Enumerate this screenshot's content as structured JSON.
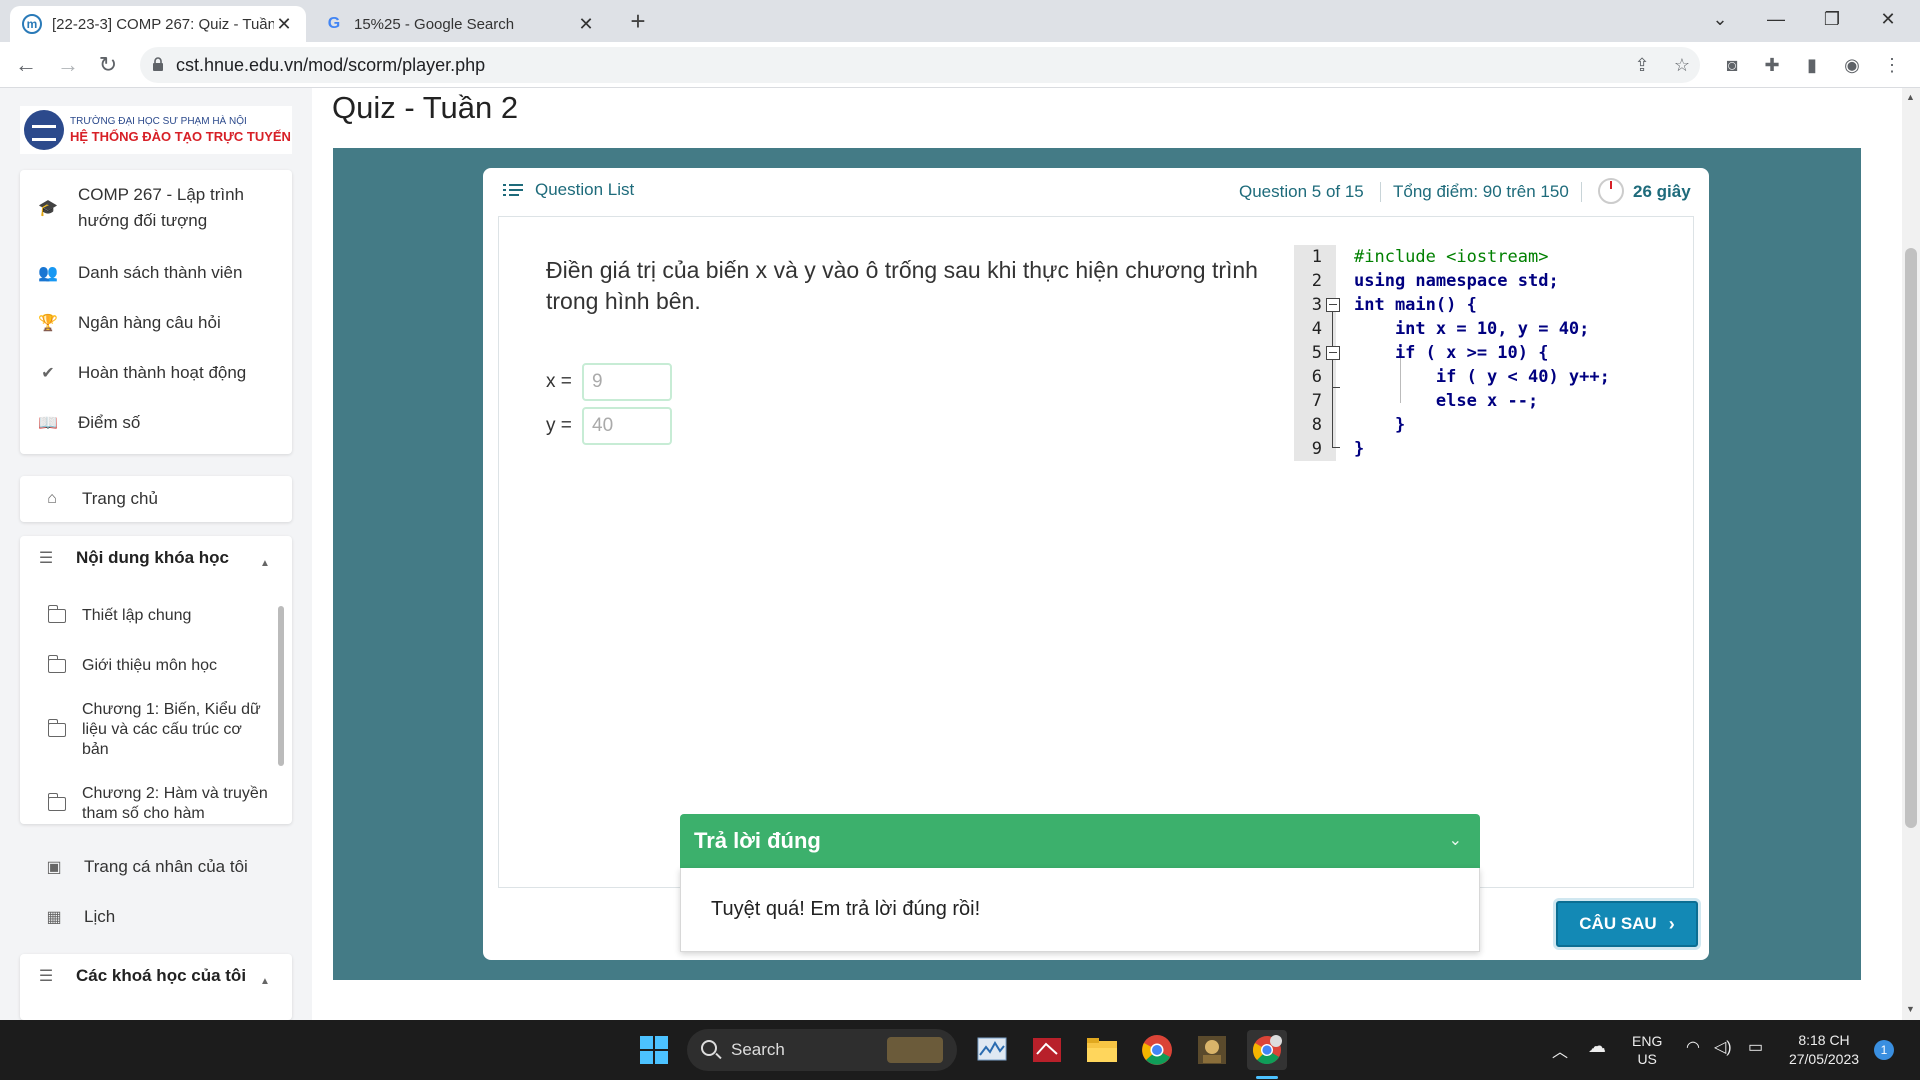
{
  "browser": {
    "tabs": [
      {
        "title": "[22-23-3] COMP 267: Quiz - Tuần",
        "active": true
      },
      {
        "title": "15%25 - Google Search",
        "active": false
      }
    ],
    "url": "cst.hnue.edu.vn/mod/scorm/player.php"
  },
  "logo": {
    "line1": "TRƯỜNG ĐẠI HỌC SƯ PHẠM HÀ NỘI",
    "line2": "HỆ THỐNG ĐÀO TẠO TRỰC TUYẾN"
  },
  "sidebar": {
    "course_items": [
      {
        "icon": "graduation-cap-icon",
        "label": "COMP 267 - Lập trình hướng đối tượng"
      },
      {
        "icon": "users-icon",
        "label": "Danh sách thành viên"
      },
      {
        "icon": "trophy-icon",
        "label": "Ngân hàng câu hỏi"
      },
      {
        "icon": "check-icon",
        "label": "Hoàn thành hoạt động"
      },
      {
        "icon": "book-icon",
        "label": "Điểm số"
      }
    ],
    "home": "Trang chủ",
    "course_content": {
      "title": "Nội dung khóa học",
      "items": [
        "Thiết lập chung",
        "Giới thiệu môn học",
        "Chương 1: Biến, Kiểu dữ liệu và các cấu trúc cơ bản",
        "Chương 2: Hàm và truyền tham số cho hàm"
      ]
    },
    "profile": "Trang cá nhân của tôi",
    "calendar": "Lịch",
    "my_courses": "Các khoá học của tôi"
  },
  "page": {
    "title": "Quiz - Tuần 2"
  },
  "quiz": {
    "question_list_label": "Question List",
    "progress": "Question 5 of 15",
    "score": "Tổng điểm: 90 trên 150",
    "timer": "26 giây",
    "question_text": "Điền giá trị của biến x và y vào ô trống sau khi thực hiện chương trình trong hình bên.",
    "answers": [
      {
        "label": "x =",
        "value": "9"
      },
      {
        "label": "y =",
        "value": "40"
      }
    ],
    "code_lines": [
      "#include <iostream>",
      "using namespace std;",
      "int main() {",
      "    int x = 10, y = 40;",
      "    if ( x >= 10) {",
      "        if ( y < 40) y++;",
      "        else x --;",
      "    }",
      "}"
    ],
    "line_numbers": [
      "1",
      "2",
      "3",
      "4",
      "5",
      "6",
      "7",
      "8",
      "9"
    ],
    "feedback_title": "Trả lời đúng",
    "feedback_message": "Tuyệt quá! Em trả lời đúng rồi!",
    "next_button": "CÂU SAU"
  },
  "taskbar": {
    "search_label": "Search",
    "lang_top": "ENG",
    "lang_bottom": "US",
    "time": "8:18 CH",
    "date": "27/05/2023",
    "notification_count": "1"
  },
  "colors": {
    "player_bg": "#447b86",
    "accent_teal": "#1e6b7b",
    "success_green": "#3cb06c",
    "next_button": "#1389b5"
  }
}
